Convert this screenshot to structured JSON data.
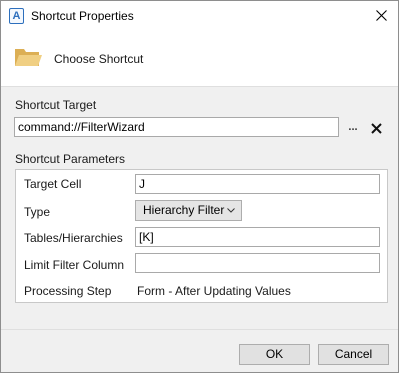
{
  "window": {
    "title": "Shortcut Properties",
    "app_icon_letter": "A",
    "icons": {
      "app": "app-icon",
      "close": "close-icon"
    }
  },
  "header": {
    "title": "Choose Shortcut",
    "icon": "folder-icon"
  },
  "shortcut_target": {
    "label": "Shortcut Target",
    "value": "command://FilterWizard",
    "browse_label": "...",
    "clear_icon": "close-icon"
  },
  "parameters": {
    "label": "Shortcut Parameters",
    "target_cell": {
      "label": "Target Cell",
      "value": "J"
    },
    "type": {
      "label": "Type",
      "value": "Hierarchy Filter",
      "icon": "chevron-down-icon"
    },
    "tables_hierarchies": {
      "label": "Tables/Hierarchies",
      "value": "[K]"
    },
    "limit_filter_column": {
      "label": "Limit Filter Column",
      "value": ""
    },
    "processing_step": {
      "label": "Processing Step",
      "value": "Form - After Updating Values"
    }
  },
  "footer": {
    "ok_label": "OK",
    "cancel_label": "Cancel"
  },
  "colors": {
    "accent": "#2d6fbd",
    "folder": "#e8c06a",
    "panel_background": "#f0f0f0"
  }
}
